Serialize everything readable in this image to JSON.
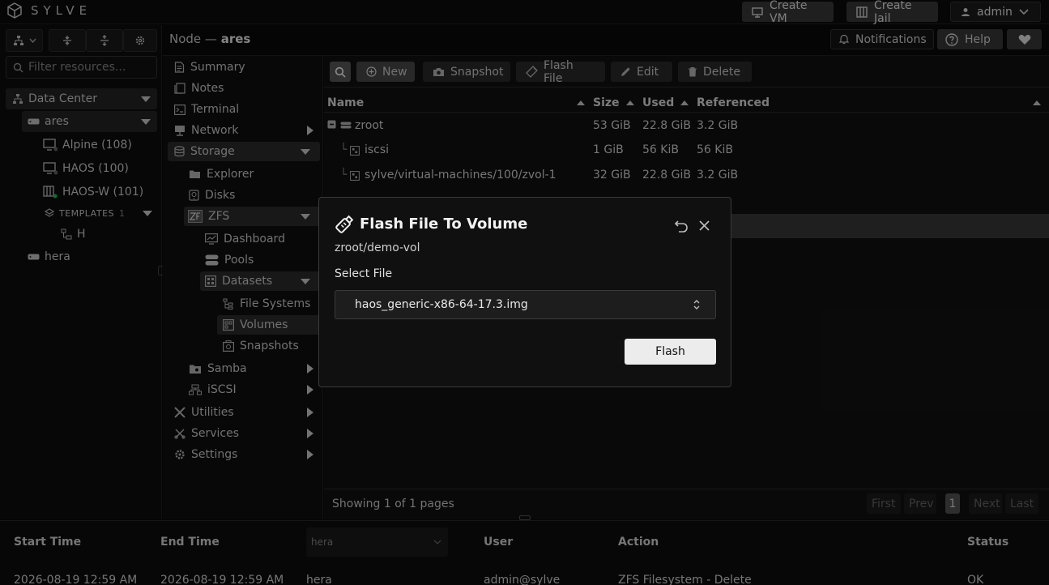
{
  "brand": {
    "name": "SYLVE"
  },
  "topbar": {
    "create_vm": "Create VM",
    "create_jail": "Create Jail",
    "user": "admin"
  },
  "sidebar": {
    "filter_placeholder": "Filter resources...",
    "datacenter": "Data Center",
    "node": "ares",
    "guests": [
      "Alpine (108)",
      "HAOS (100)",
      "HAOS-W (101)"
    ],
    "templates_label": "TEMPLATES",
    "templates_count": "1",
    "template_item": "H",
    "other_node": "hera"
  },
  "header": {
    "node_prefix": "Node —",
    "node_name": "ares",
    "notifications": "Notifications",
    "help": "Help"
  },
  "nav": {
    "summary": "Summary",
    "notes": "Notes",
    "terminal": "Terminal",
    "network": "Network",
    "storage": "Storage",
    "explorer": "Explorer",
    "disks": "Disks",
    "zfs": "ZFS",
    "dashboard": "Dashboard",
    "pools": "Pools",
    "datasets": "Datasets",
    "file_systems": "File Systems",
    "volumes": "Volumes",
    "snapshots": "Snapshots",
    "samba": "Samba",
    "iscsi": "iSCSI",
    "utilities": "Utilities",
    "services": "Services",
    "settings": "Settings"
  },
  "toolbar": {
    "new": "New",
    "snapshot": "Snapshot",
    "flash_file": "Flash File",
    "edit": "Edit",
    "delete": "Delete"
  },
  "table": {
    "columns": [
      "Name",
      "Size",
      "Used",
      "Referenced"
    ],
    "rows": [
      {
        "name": "zroot",
        "size": "53 GiB",
        "used": "22.8 GiB",
        "referenced": "3.2 GiB"
      },
      {
        "name": "iscsi",
        "size": "1 GiB",
        "used": "56 KiB",
        "referenced": "56 KiB"
      },
      {
        "name": "sylve/virtual-machines/100/zvol-1",
        "size": "32 GiB",
        "used": "22.8 GiB",
        "referenced": "3.2 GiB"
      }
    ],
    "footer": "Showing 1 of 1 pages",
    "pager": {
      "first": "First",
      "prev": "Prev",
      "page": "1",
      "next": "Next",
      "last": "Last"
    }
  },
  "tasks": {
    "columns": {
      "start": "Start Time",
      "end": "End Time",
      "node_filter": "hera",
      "user": "User",
      "action": "Action",
      "status": "Status"
    },
    "row": {
      "start": "2026-08-19 12:59 AM",
      "end": "2026-08-19 12:59 AM",
      "node": "hera",
      "user": "admin@sylve",
      "action": "ZFS Filesystem - Delete",
      "status": "OK"
    }
  },
  "modal": {
    "title": "Flash File To Volume",
    "subtitle": "zroot/demo-vol",
    "select_label": "Select File",
    "selected_file": "haos_generic-x86-64-17.3.img",
    "flash_button": "Flash"
  }
}
